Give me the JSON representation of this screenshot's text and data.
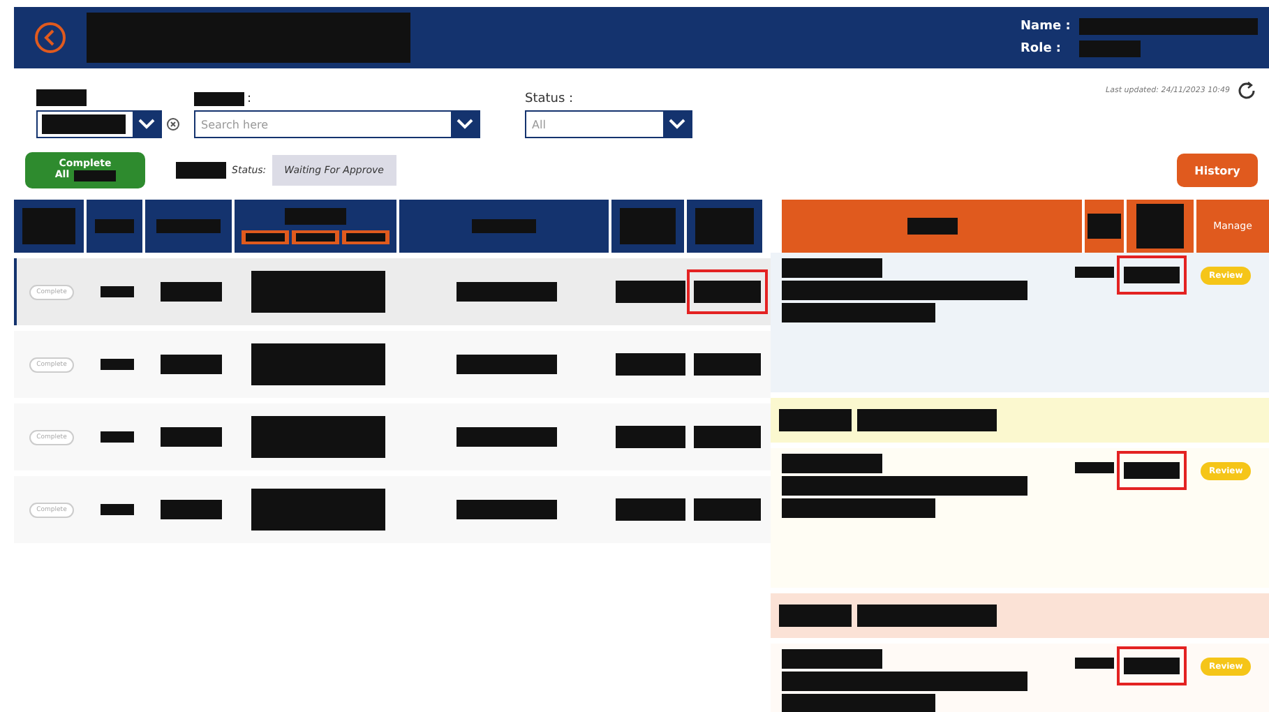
{
  "header": {
    "title": {
      "kind": "redacted"
    },
    "fields": [
      {
        "label": "Name :",
        "value": {
          "kind": "redacted"
        }
      },
      {
        "label": "Role :",
        "value": {
          "kind": "redacted"
        }
      }
    ]
  },
  "filters": [
    {
      "kind": "redacted-select"
    },
    {
      "kind": "search",
      "label_suffix": ":",
      "placeholder": "Search here"
    },
    {
      "kind": "select",
      "label": "Status :",
      "value": "All"
    }
  ],
  "last_updated": "Last updated: 24/11/2023 10:49",
  "actions": {
    "complete_all": [
      "Complete",
      "All"
    ],
    "status_label": "Status:",
    "status_value": "Waiting For Approve",
    "history": "History"
  },
  "left_table": {
    "columns": [
      {
        "kind": "redacted"
      },
      {
        "kind": "redacted"
      },
      {
        "kind": "redacted"
      },
      {
        "kind": "group"
      },
      {
        "kind": "redacted"
      },
      {
        "kind": "redacted"
      },
      {
        "kind": "redacted"
      }
    ],
    "rows": [
      {
        "selected": true,
        "action": "Complete",
        "highlighted": true
      },
      {
        "selected": false,
        "action": "Complete",
        "highlighted": false
      },
      {
        "selected": false,
        "action": "Complete",
        "highlighted": false
      },
      {
        "selected": false,
        "action": "Complete",
        "highlighted": false
      }
    ]
  },
  "right_panel": {
    "manage": "Manage",
    "items": [
      {
        "kind": "entry",
        "color": "#eef3f8",
        "action": "Review",
        "highlighted": true
      },
      {
        "kind": "group",
        "color": "#fbf8cf"
      },
      {
        "kind": "entry",
        "color": "#fffdf4",
        "action": "Review",
        "highlighted": true
      },
      {
        "kind": "group",
        "color": "#fbe2d6"
      },
      {
        "kind": "entry",
        "color": "#fffaf6",
        "action": "Review",
        "highlighted": true
      }
    ]
  }
}
